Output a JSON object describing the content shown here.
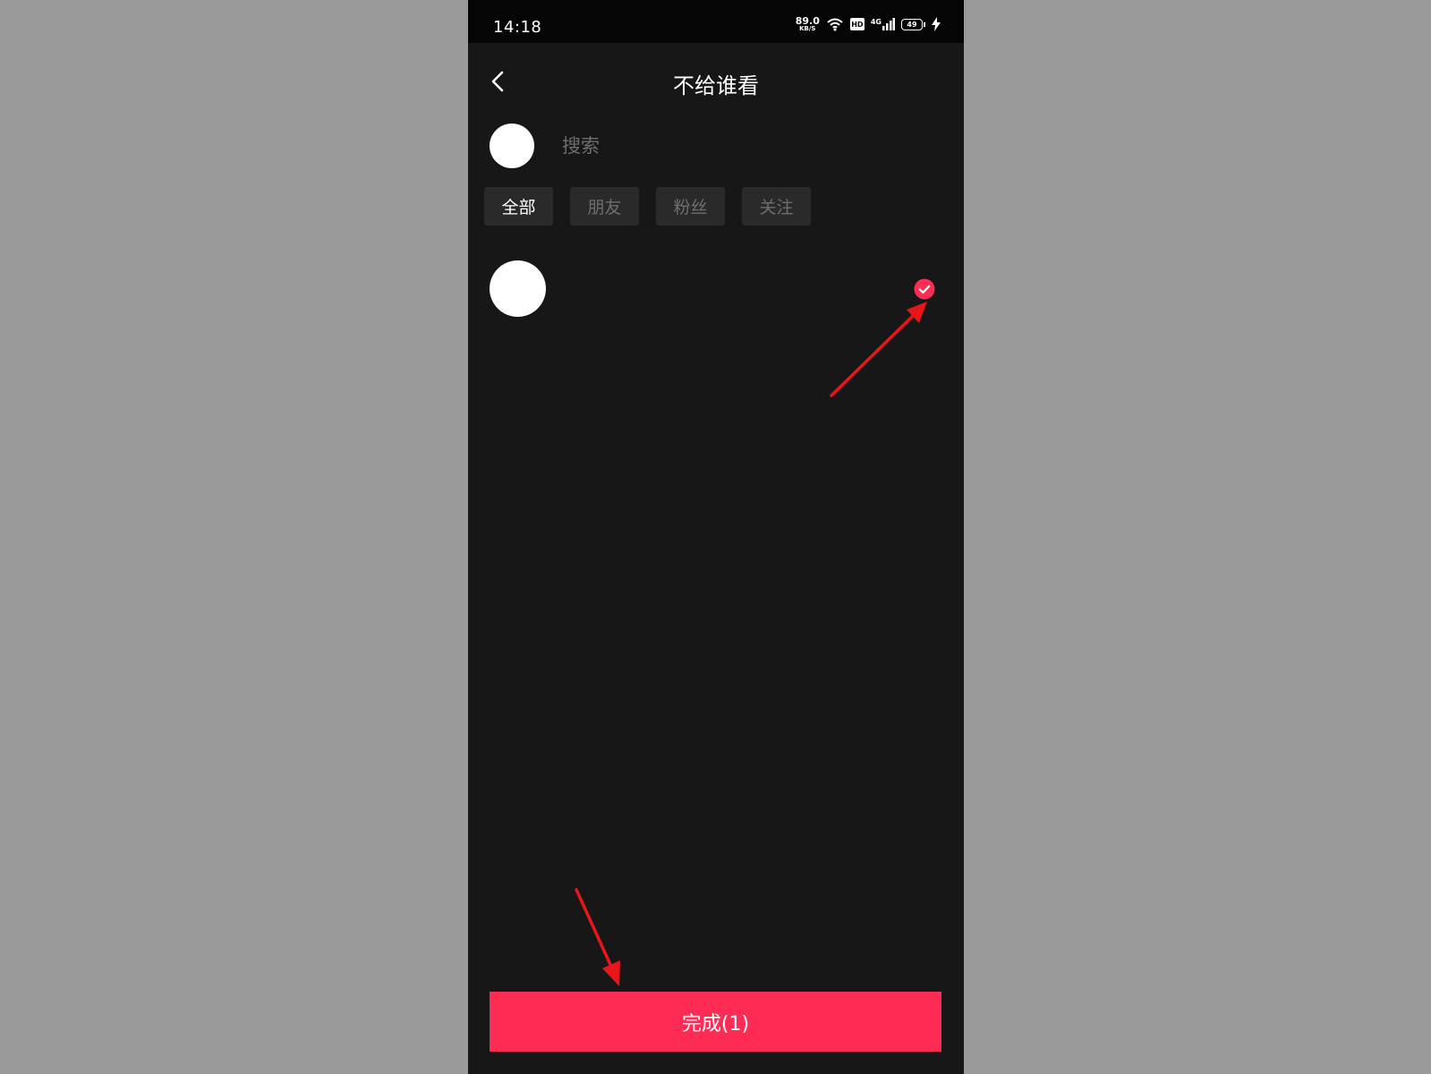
{
  "status_bar": {
    "time": "14:18",
    "net_speed_value": "89.0",
    "net_speed_unit": "KB/S",
    "hd_label": "HD",
    "network_label": "4G",
    "battery_level": "49"
  },
  "header": {
    "title": "不给谁看"
  },
  "search": {
    "placeholder": "搜索"
  },
  "tabs": [
    {
      "label": "全部",
      "active": true
    },
    {
      "label": "朋友",
      "active": false
    },
    {
      "label": "粉丝",
      "active": false
    },
    {
      "label": "关注",
      "active": false
    }
  ],
  "list": {
    "items": [
      {
        "selected": true
      }
    ]
  },
  "footer": {
    "done_label": "完成(1)"
  },
  "colors": {
    "accent": "#fe2c55",
    "background": "#171717",
    "annotation_arrow": "#e8161b"
  }
}
